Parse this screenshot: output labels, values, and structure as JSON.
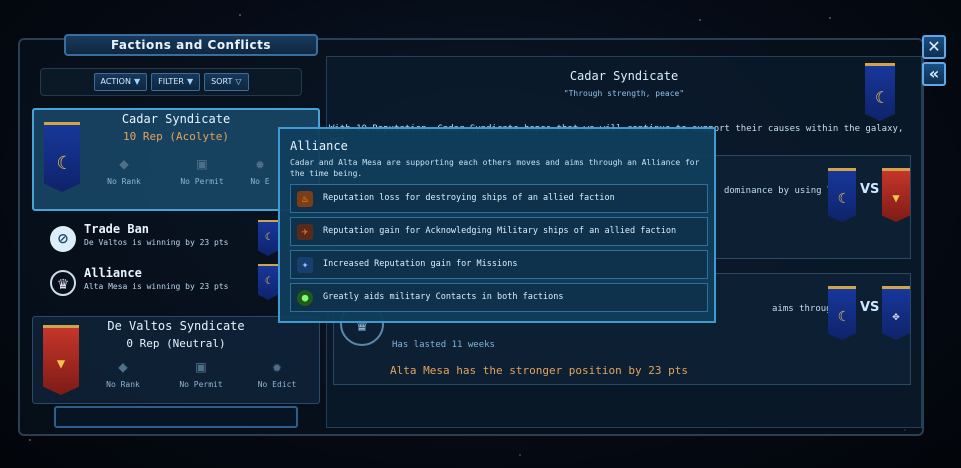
{
  "window": {
    "title": "Factions and Conflicts"
  },
  "toolbar": {
    "action_label": "ACTION",
    "filter_label": "FILTER",
    "sort_label": "SORT"
  },
  "factions": [
    {
      "name": "Cadar Syndicate",
      "rep": "10 Rep (Acolyte)",
      "statuses": [
        "No Rank",
        "No Permit",
        "No E"
      ]
    },
    {
      "name": "De Valtos Syndicate",
      "rep": "0 Rep (Neutral)",
      "statuses": [
        "No Rank",
        "No Permit",
        "No Edict"
      ]
    }
  ],
  "conflicts": [
    {
      "title": "Trade Ban",
      "subtitle": "De Valtos is winning by 23 pts"
    },
    {
      "title": "Alliance",
      "subtitle": "Alta Mesa is winning by 23 pts"
    }
  ],
  "detail": {
    "title": "Cadar Syndicate",
    "motto": "\"Through strength, peace\"",
    "description": "With 10 Reputation, Cadar Syndicate hopes that we will continue to support their causes within the galaxy, but",
    "relation1_text": "dominance by using Trade",
    "relation2_text": "aims through an",
    "vs_label": "VS",
    "lasted": "Has lasted 11 weeks",
    "stronger": "Alta Mesa has the stronger position by 23 pts"
  },
  "tooltip": {
    "title": "Alliance",
    "description": "Cadar and Alta Mesa are supporting each others moves and aims through an Alliance for the time being.",
    "effects": [
      "Reputation loss for destroying ships of an allied faction",
      "Reputation gain for Acknowledging Military ships of an allied faction",
      "Increased Reputation gain for Missions",
      "Greatly aids military Contacts in both factions"
    ]
  },
  "controls": {
    "close": "✕",
    "collapse": "«"
  }
}
